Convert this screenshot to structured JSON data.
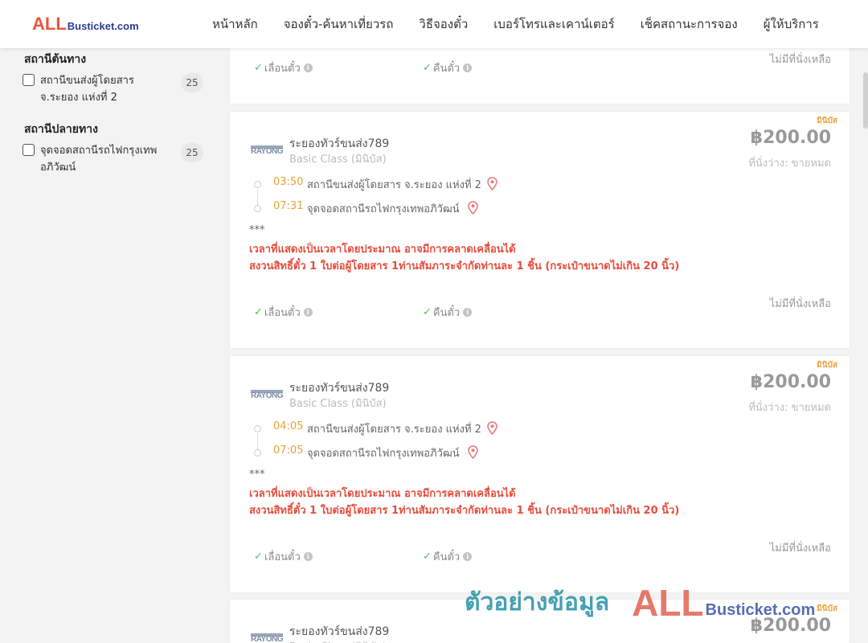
{
  "header": {
    "logo_all": "ALL",
    "logo_rest": "Busticket.com",
    "nav": [
      "หน้าหลัก",
      "จองตั๋ว-ค้นหาเที่ยวรถ",
      "วิธีจองตั๋ว",
      "เบอร์โทรและเคาน์เตอร์",
      "เช็คสถานะการจอง",
      "ผู้ให้บริการ"
    ]
  },
  "sidebar": {
    "origin_title": "สถานีต้นทาง",
    "origin_items": [
      {
        "label": "สถานีขนส่งผู้โดยสาร จ.ระยอง แห่งที่ 2",
        "count": "25"
      }
    ],
    "dest_title": "สถานีปลายทาง",
    "dest_items": [
      {
        "label": "จุดจอดสถานีรถไฟกรุงเทพอภิวัฒน์",
        "count": "25"
      }
    ]
  },
  "common": {
    "reschedule": "เลื่อนตั๋ว",
    "refund": "คืนตั๋ว",
    "no_seat": "ไม่มีที่นั่งเหลือ",
    "mini_tag": "มินิบัส",
    "operator_logo": "RAYONG",
    "operator": "ระยองทัวร์ขนส่ง789",
    "bus_class": "Basic Class (มินิบัส)",
    "price": "฿200.00",
    "seats": "ที่นั่งว่าง: ขายหมด",
    "stars": "***",
    "warn1": "เวลาที่แสดงเป็นเวลาโดยประมาณ อาจมีการคลาดเคลื่อนได้",
    "warn2": "สงวนสิทธิ์ตั๋ว 1 ใบต่อผู้โดยสาร 1ท่านสัมภาระจำกัดท่านละ 1 ชิ้น (กระเป๋าขนาดไม่เกิน 20 นิ้ว)",
    "origin": "สถานีขนส่งผู้โดยสาร จ.ระยอง แห่งที่ 2",
    "destination": "จุดจอดสถานีรถไฟกรุงเทพอภิวัฒน์"
  },
  "trips": [
    {
      "depart": "03:50",
      "arrive": "07:31"
    },
    {
      "depart": "04:05",
      "arrive": "07:05"
    }
  ],
  "watermark": {
    "text": "ตัวอย่างข้อมูล",
    "all": "ALL",
    "rest": "Busticket.com"
  },
  "colors": {
    "accent": "#e8a23d",
    "warning": "#e74c3c",
    "brand_red": "#e8573d",
    "brand_blue": "#2c3e8f"
  }
}
